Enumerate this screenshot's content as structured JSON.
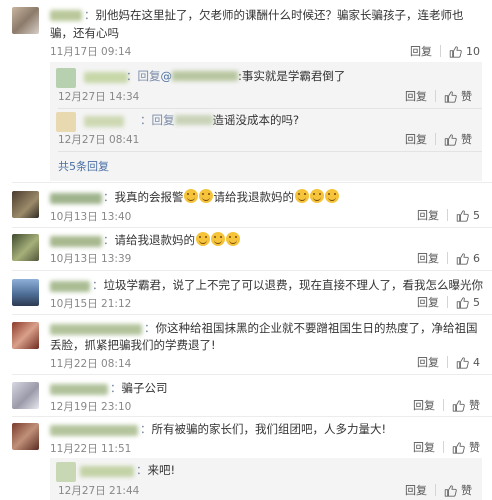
{
  "comments": [
    {
      "name_suffix": "：",
      "text_line1": "别他妈在这里扯了，欠老师的课酬什么时候还？骗家长骗孩子，连老师也",
      "text_line2": "骗，还有心吗",
      "date": "11月17日 09:14",
      "reply": "回复",
      "likes": "10",
      "subreplies": [
        {
          "prefix": "：回复",
          "at": "@",
          "text": ":事实就是学霸君倒了",
          "date": "12月27日 14:34",
          "reply": "回复",
          "like": "赞"
        },
        {
          "prefix": "：回复",
          "text": "造谣没成本的吗?",
          "date": "12月27日 08:41",
          "reply": "回复",
          "like": "赞"
        }
      ],
      "more": "共5条回复"
    },
    {
      "name_suffix": "：",
      "text": "我真的会报警",
      "text2": "请给我退款妈的",
      "date": "10月13日 13:40",
      "reply": "回复",
      "likes": "5"
    },
    {
      "name_suffix": "：",
      "text": "请给我退款妈的",
      "date": "10月13日 13:39",
      "reply": "回复",
      "likes": "6"
    },
    {
      "name_suffix": "：",
      "text": "垃圾学霸君，说了上不完了可以退费，现在直接不理人了，看我怎么曝光你",
      "date": "10月15日 21:12",
      "reply": "回复",
      "likes": "5"
    },
    {
      "name_suffix": "：",
      "text_line1": "你这种给祖国抹黑的企业就不要蹭祖国生日的热度了，净给祖国",
      "text_line2": "丢脸，抓紧把骗我们的学费退了!",
      "date": "11月22日 08:14",
      "reply": "回复",
      "likes": "4"
    },
    {
      "name_suffix": "：",
      "text": "骗子公司",
      "date": "12月19日 23:10",
      "reply": "回复",
      "likes": "赞"
    },
    {
      "name_suffix": "：",
      "text": "所有被骗的家长们，我们组团吧，人多力量大!",
      "date": "11月22日 11:51",
      "reply": "回复",
      "likes": "赞"
    },
    {
      "name_suffix": "：",
      "text": "来吧!",
      "date": "12月27日 21:44",
      "reply": "回复",
      "likes": "赞"
    }
  ],
  "icons": {
    "like": "thumbs-up-icon",
    "emoji": "smile-emoji-icon"
  },
  "colors": {
    "link": "#4a6fa5",
    "meta": "#888888",
    "subpanel": "#f4f4f4"
  }
}
